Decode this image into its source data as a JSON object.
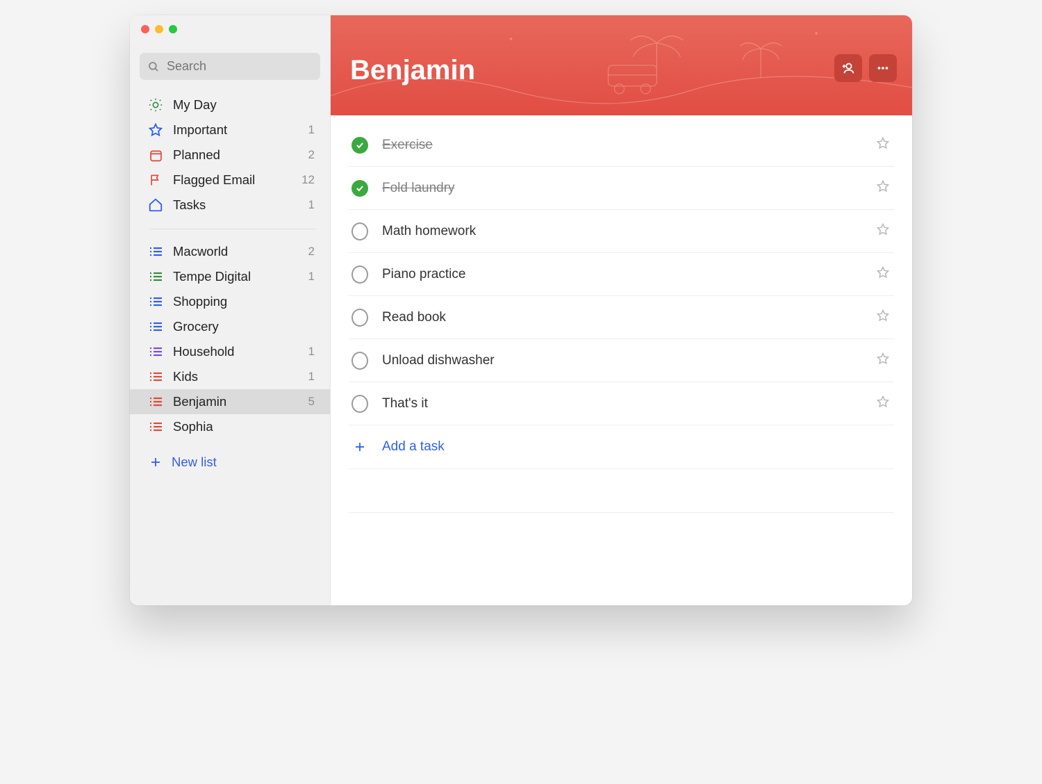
{
  "search": {
    "placeholder": "Search"
  },
  "smart": [
    {
      "icon": "sun",
      "label": "My Day",
      "count": ""
    },
    {
      "icon": "star",
      "label": "Important",
      "count": "1"
    },
    {
      "icon": "calendar",
      "label": "Planned",
      "count": "2"
    },
    {
      "icon": "flag",
      "label": "Flagged Email",
      "count": "12"
    },
    {
      "icon": "home",
      "label": "Tasks",
      "count": "1"
    }
  ],
  "lists": [
    {
      "color": "#2f5fea",
      "label": "Macworld",
      "count": "2",
      "selected": false
    },
    {
      "color": "#2f8f3e",
      "label": "Tempe Digital",
      "count": "1",
      "selected": false
    },
    {
      "color": "#2f5fea",
      "label": "Shopping",
      "count": "",
      "selected": false
    },
    {
      "color": "#2f5fea",
      "label": "Grocery",
      "count": "",
      "selected": false
    },
    {
      "color": "#7a4adf",
      "label": "Household",
      "count": "1",
      "selected": false
    },
    {
      "color": "#dd4a3a",
      "label": "Kids",
      "count": "1",
      "selected": false
    },
    {
      "color": "#dd4a3a",
      "label": "Benjamin",
      "count": "5",
      "selected": true
    },
    {
      "color": "#dd4a3a",
      "label": "Sophia",
      "count": "",
      "selected": false
    }
  ],
  "newlist": "New list",
  "header": {
    "title": "Benjamin"
  },
  "tasks": [
    {
      "title": "Exercise",
      "done": true,
      "starred": false
    },
    {
      "title": "Fold laundry",
      "done": true,
      "starred": false
    },
    {
      "title": "Math homework",
      "done": false,
      "starred": false
    },
    {
      "title": "Piano practice",
      "done": false,
      "starred": false
    },
    {
      "title": "Read book",
      "done": false,
      "starred": false
    },
    {
      "title": "Unload dishwasher",
      "done": false,
      "starred": false
    },
    {
      "title": "That's it",
      "done": false,
      "starred": false
    }
  ],
  "add_task": "Add a task"
}
